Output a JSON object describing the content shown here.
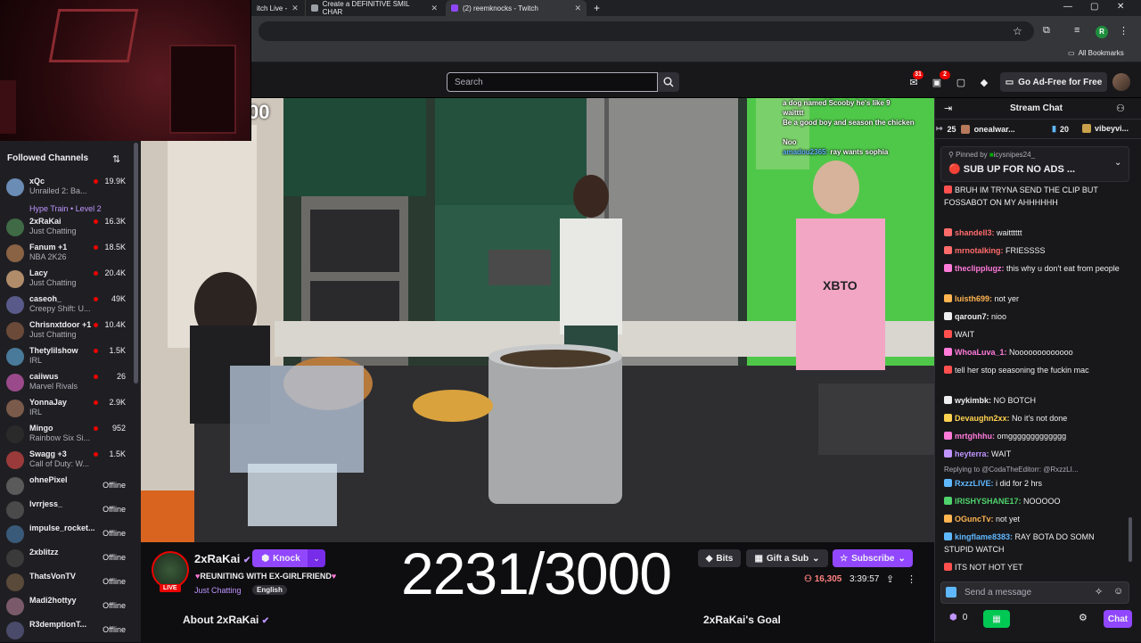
{
  "browser": {
    "tabs": [
      {
        "label": "itch Live -"
      },
      {
        "label": "Create a DEFINITIVE SMIL CHAR"
      },
      {
        "label": "(2) reemknocks - Twitch"
      }
    ],
    "all_bookmarks": "All Bookmarks",
    "profile_initial": "R"
  },
  "topnav": {
    "search_placeholder": "Search",
    "notif_count": "31",
    "inbox_count": "2",
    "adfree_label": "Go Ad-Free for Free"
  },
  "sidebar": {
    "heading": "Followed Channels",
    "channels": [
      {
        "name": "xQc",
        "sub": "Unrailed 2: Ba...",
        "viewers": "19.9K",
        "color": "#6b8cb5"
      },
      {
        "name": "",
        "sub": "Hype Train • Level 2",
        "viewers": "",
        "color": ""
      },
      {
        "name": "2xRaKai",
        "sub": "Just Chatting",
        "viewers": "16.3K",
        "color": "#3f6a45"
      },
      {
        "name": "Fanum +1",
        "sub": "NBA 2K26",
        "viewers": "18.5K",
        "color": "#8a6244"
      },
      {
        "name": "Lacy",
        "sub": "Just Chatting",
        "viewers": "20.4K",
        "color": "#b08c6b"
      },
      {
        "name": "caseoh_",
        "sub": "Creepy Shift: U...",
        "viewers": "49K",
        "color": "#5a5a8a"
      },
      {
        "name": "Chrisnxtdoor +1",
        "sub": "Just Chatting",
        "viewers": "10.4K",
        "color": "#6b4a3a"
      },
      {
        "name": "Thetylilshow",
        "sub": "IRL",
        "viewers": "1.5K",
        "color": "#4a7a9a"
      },
      {
        "name": "caiiwus",
        "sub": "Marvel Rivals",
        "viewers": "26",
        "color": "#9a4a8a"
      },
      {
        "name": "YonnaJay",
        "sub": "IRL",
        "viewers": "2.9K",
        "color": "#7a5a4a"
      },
      {
        "name": "Mingo",
        "sub": "Rainbow Six Si...",
        "viewers": "952",
        "color": "#2a2a2a"
      },
      {
        "name": "Swagg +3",
        "sub": "Call of Duty: W...",
        "viewers": "1.5K",
        "color": "#9a3a3a"
      },
      {
        "name": "ohnePixel",
        "sub": "",
        "viewers": "Offline",
        "color": "#5a5a5a"
      },
      {
        "name": "lvrrjess_",
        "sub": "",
        "viewers": "Offline",
        "color": "#4a4a4a"
      },
      {
        "name": "impulse_rocket...",
        "sub": "",
        "viewers": "Offline",
        "color": "#3a5a7a"
      },
      {
        "name": "2xblitzz",
        "sub": "",
        "viewers": "Offline",
        "color": "#3a3a3a"
      },
      {
        "name": "ThatsVonTV",
        "sub": "",
        "viewers": "Offline",
        "color": "#5a4a3a"
      },
      {
        "name": "Madi2hottyy",
        "sub": "",
        "viewers": "Offline",
        "color": "#7a5a6a"
      },
      {
        "name": "R3demptionT...",
        "sub": "",
        "viewers": "Offline",
        "color": "#4a4a6a"
      }
    ]
  },
  "video": {
    "overlay_chat": [
      {
        "user": "",
        "text": "a dog named Scooby he's like 9"
      },
      {
        "user": "",
        "text": "waitttt"
      },
      {
        "user": "",
        "text": "Be a good boy and season the chicken"
      },
      {
        "user": "",
        "text": "Noo"
      },
      {
        "user": "amadou2365:",
        "text": "ray wants sophia"
      }
    ],
    "counter": "2231/3000",
    "corner_digits": "00",
    "jersey": "XBTO"
  },
  "stream": {
    "streamer": "2xRaKai",
    "live": "LIVE",
    "knock": "Knock",
    "title": "REUNITING WITH EX-GIRLFRIEND",
    "category": "Just Chatting",
    "language": "English",
    "bits": "Bits",
    "gift": "Gift a Sub",
    "subscribe": "Subscribe",
    "viewers": "16,305",
    "uptime": "3:39:57",
    "about": "About 2xRaKai",
    "goal": "2xRaKai's Goal"
  },
  "chat": {
    "title": "Stream Chat",
    "leaderboard": [
      {
        "rank": "25",
        "name": "onealwar..."
      },
      {
        "rank": "20",
        "name": "vibeyvi..."
      }
    ],
    "pinned_by": "Pinned by",
    "pinned_user": "icysnipes24_",
    "pinned_text": "SUB UP FOR NO ADS ...",
    "messages": [
      {
        "user": "",
        "color": "#ff4f4f",
        "text": "BRUH IM TRYNA SEND THE CLIP BUT FOSSABOT ON MY AHHHHHH"
      },
      {
        "user": "shandell3:",
        "color": "#ff6b6b",
        "text": "waitttttt"
      },
      {
        "user": "mrnotalking:",
        "color": "#ff6b6b",
        "text": "FRIESSSS"
      },
      {
        "user": "theclipplugz:",
        "color": "#ff7ad9",
        "text": "this why u don't eat from people"
      },
      {
        "user": "luisth699:",
        "color": "#ffb44f",
        "text": "not yer"
      },
      {
        "user": "qaroun7:",
        "color": "#efeff1",
        "text": "nioo"
      },
      {
        "user": "",
        "color": "#ff4f4f",
        "text": "WAIT"
      },
      {
        "user": "WhoaLuva_1:",
        "color": "#ff7ad9",
        "text": "Nooooooooooooo"
      },
      {
        "user": "",
        "color": "#ff4f4f",
        "text": "tell her stop seasoning the fuckin mac"
      },
      {
        "user": "wykimbk:",
        "color": "#efeff1",
        "text": "NO BOTCH"
      },
      {
        "user": "Devaughn2xx:",
        "color": "#ffd24f",
        "text": "No it's not done"
      },
      {
        "user": "mrtghhhu:",
        "color": "#ff7ad9",
        "text": "omggggggggggggg"
      },
      {
        "user": "heyterra:",
        "color": "#bf94ff",
        "text": "WAIT"
      },
      {
        "user": "",
        "color": "#adadb8",
        "text": "Replying to @CodaTheEditorr: @RxzzLI..."
      },
      {
        "user": "RxzzLIVE:",
        "color": "#5fb8ff",
        "text": "i did for 2 hrs"
      },
      {
        "user": "IRISHYSHANE17:",
        "color": "#4fd26b",
        "text": "NOOOOO"
      },
      {
        "user": "OGuncTv:",
        "color": "#ffb44f",
        "text": "not yet"
      },
      {
        "user": "kingflame8383:",
        "color": "#5fb8ff",
        "text": "RAY BOTA DO SOMN STUPID WATCH"
      },
      {
        "user": "",
        "color": "#ff4f4f",
        "text": "ITS NOT HOT YET"
      }
    ],
    "input_placeholder": "Send a message",
    "points": "0",
    "chat_button": "Chat"
  }
}
